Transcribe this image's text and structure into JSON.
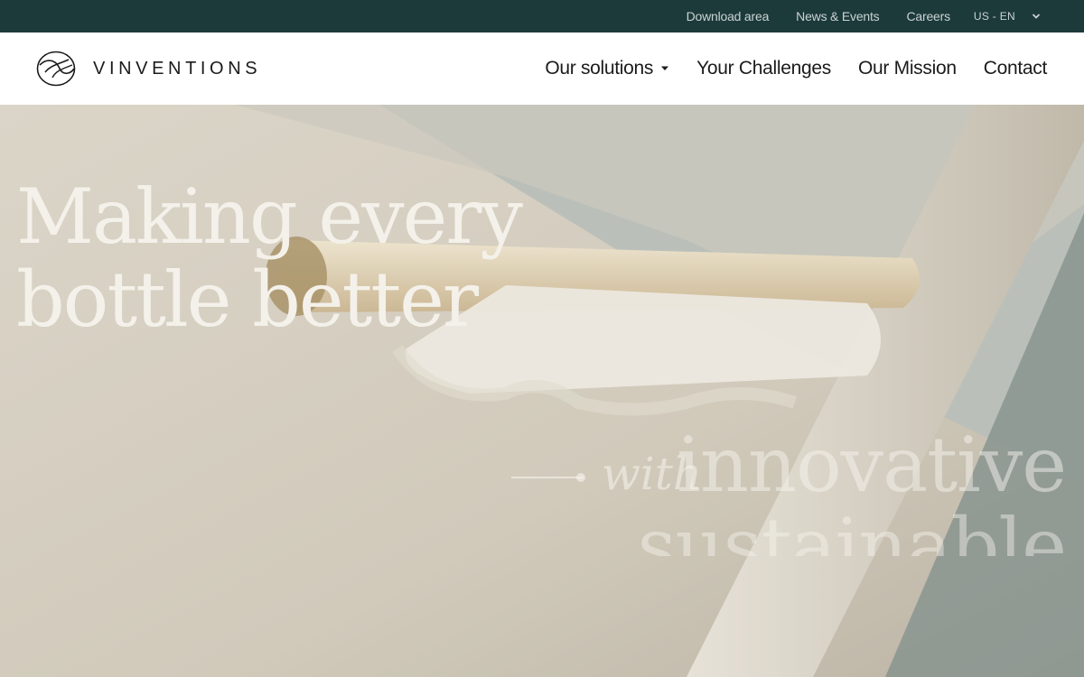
{
  "topbar": {
    "links": [
      "Download area",
      "News & Events",
      "Careers"
    ],
    "language": "US - EN"
  },
  "header": {
    "brand": "VINVENTIONS",
    "nav": {
      "solutions": "Our solutions",
      "challenges": "Your Challenges",
      "mission": "Our Mission",
      "contact": "Contact"
    }
  },
  "hero": {
    "headline_line1": "Making every",
    "headline_line2": "bottle better",
    "tagline_with": "with",
    "tagline_word1": "innovative",
    "tagline_word2": "sustainable"
  },
  "colors": {
    "topbar_bg": "#1d3a3b",
    "topbar_text": "#c9d3d2",
    "header_bg": "#ffffff",
    "nav_text": "#1b1b1b",
    "hero_text": "#f4f1ea"
  },
  "icons": {
    "logo": "leaf-logo-icon",
    "language_toggle": "chevron-down-icon",
    "solutions_caret": "caret-down-icon"
  }
}
